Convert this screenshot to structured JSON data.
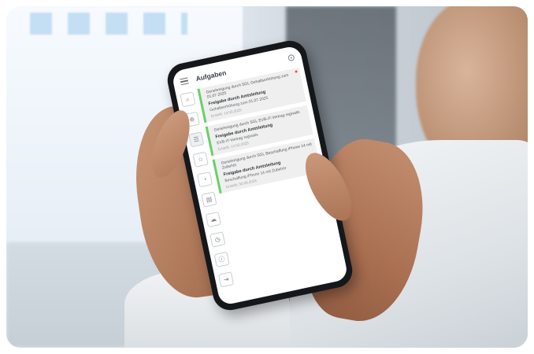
{
  "app": {
    "title": "Aufgaben"
  },
  "side_rail": [
    {
      "icon": "search-icon",
      "glyph": "⌕"
    },
    {
      "icon": "zoom-icon",
      "glyph": "⊕"
    },
    {
      "icon": "list-icon",
      "glyph": "☰"
    },
    {
      "icon": "star-icon",
      "glyph": "☆"
    },
    {
      "icon": "timer-icon",
      "glyph": "◔"
    },
    {
      "icon": "document-icon",
      "glyph": "▤"
    },
    {
      "icon": "cloud-icon",
      "glyph": "☁"
    },
    {
      "icon": "clock-icon",
      "glyph": "◷"
    },
    {
      "icon": "info-icon",
      "glyph": "ⓘ"
    },
    {
      "icon": "logout-icon",
      "glyph": "⇥"
    }
  ],
  "tasks": [
    {
      "title": "Genehmigung durch SGL Gehaltserhöhung zum 01.07.2025",
      "step": "Freigabe durch Amtsleitung",
      "desc": "Gehaltserhöhung zum 01.07.2025",
      "date": "Erstellt: 14.03.2025",
      "status_color": "#6ccf6a"
    },
    {
      "title": "Genehmigung durch SGL EVB-IT-Vertrag regivalis",
      "step": "Freigabe durch Amtsleitung",
      "desc": "EVB-IT-Vertrag regivalis",
      "date": "Erstellt: 14.03.2025",
      "status_color": "#6ccf6a"
    },
    {
      "title": "Genehmigung durch SGL Beschaffung iPhone 14 mit Zubehör",
      "step": "Freigabe durch Amtsleitung",
      "desc": "Beschaffung iPhone 14 mit Zubehör",
      "date": "Erstellt: 30.09.2024",
      "status_color": "#6ccf6a"
    }
  ]
}
